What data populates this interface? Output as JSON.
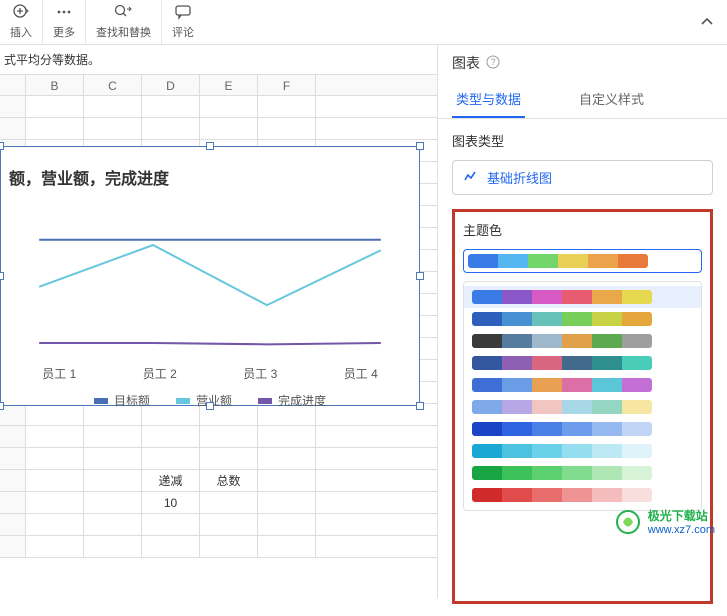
{
  "toolbar": {
    "insert_label": "插入",
    "more_label": "更多",
    "find_replace_label": "查找和替换",
    "comment_label": "评论"
  },
  "sheet": {
    "info_line": "式平均分等数据。",
    "columns": [
      "",
      "B",
      "C",
      "D",
      "E",
      "F",
      ""
    ],
    "data_cells": {
      "label_decrease": "递减",
      "label_total": "总数",
      "value_10": "10"
    }
  },
  "chart_data": {
    "type": "line",
    "title": "额，营业额，完成进度",
    "categories": [
      "员工 1",
      "员工 2",
      "员工 3",
      "员工 4"
    ],
    "series": [
      {
        "name": "目标额",
        "color": "#4a6fb5",
        "values": [
          80,
          80,
          80,
          80
        ]
      },
      {
        "name": "营业额",
        "color": "#66c7de",
        "values": [
          44,
          76,
          30,
          72
        ]
      },
      {
        "name": "完成进度",
        "color": "#7256a8",
        "values": [
          1,
          1,
          0,
          1
        ]
      }
    ],
    "ylim": [
      0,
      100
    ]
  },
  "panel": {
    "header": "图表",
    "tabs": {
      "type_data": "类型与数据",
      "custom_style": "自定义样式"
    },
    "chart_type_label": "图表类型",
    "chart_type_value": "基础折线图",
    "theme_label": "主题色",
    "selected_theme": [
      "#3b7be8",
      "#55b6f0",
      "#73d66a",
      "#e9cf55",
      "#eca24a",
      "#e77a3a"
    ],
    "theme_options": [
      [
        "#3b7be8",
        "#8a58c8",
        "#d85bc5",
        "#e85b70",
        "#e9a94a",
        "#e6d94f"
      ],
      [
        "#2f5fbd",
        "#4790d2",
        "#66c1b8",
        "#77cf59",
        "#c7d344",
        "#e5a63c"
      ],
      [
        "#3a3a3a",
        "#557c9e",
        "#a0b8cc",
        "#e0a14a",
        "#5da94f",
        "#9e9e9e"
      ],
      [
        "#3356a0",
        "#8e5fb3",
        "#d96580",
        "#426a8c",
        "#2f8e8e",
        "#49cdb8"
      ],
      [
        "#3d6fd6",
        "#6a9de6",
        "#e9a052",
        "#db6fa6",
        "#5cc6d9",
        "#c46fd6"
      ],
      [
        "#7fa9e8",
        "#b8a7e6",
        "#f1c5c2",
        "#a8d8e8",
        "#95d6c2",
        "#f6e6a1"
      ],
      [
        "#1a43c6",
        "#2f64e0",
        "#4a7fe6",
        "#6d9ced",
        "#97b9f1",
        "#c1d5f6"
      ],
      [
        "#1aa7d4",
        "#4cc1e0",
        "#6bd1ea",
        "#94def0",
        "#bce9f4",
        "#def3f9"
      ],
      [
        "#1aa545",
        "#3bc158",
        "#5bd06f",
        "#82dc8f",
        "#aee7b3",
        "#d6f2d7"
      ],
      [
        "#d12a2a",
        "#e04c4c",
        "#e86e6e",
        "#ef9494",
        "#f4bcbc",
        "#f9dede"
      ]
    ]
  },
  "watermark": {
    "name": "极光下载站",
    "url": "www.xz7.com"
  }
}
